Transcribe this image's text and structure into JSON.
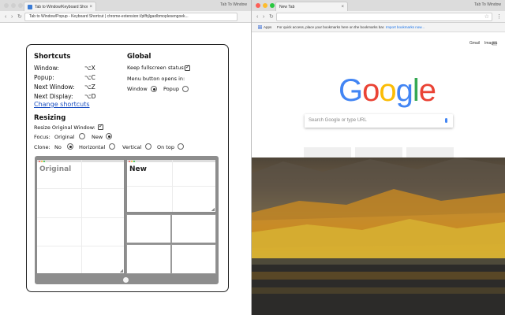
{
  "left_window": {
    "tab_title": "Tab to Window/Keyboard Shor",
    "window_title": "Tab To Window",
    "address": "Tab to Window/Popup - Keyboard Shortcut | chrome-extension://plfhjlgaolbmoplesengoek...",
    "popup": {
      "shortcuts": {
        "heading": "Shortcuts",
        "rows": [
          {
            "label": "Window:",
            "key": "⌥X"
          },
          {
            "label": "Popup:",
            "key": "⌥C"
          },
          {
            "label": "Next Window:",
            "key": "⌥Z"
          },
          {
            "label": "Next Display:",
            "key": "⌥D"
          }
        ],
        "change_link": "Change shortcuts"
      },
      "global": {
        "heading": "Global",
        "keep_fullscreen_label": "Keep fullscreen status:",
        "keep_fullscreen_checked": true,
        "menu_opens_label": "Menu button opens in:",
        "options": [
          {
            "label": "Window",
            "selected": true
          },
          {
            "label": "Popup",
            "selected": false
          }
        ]
      },
      "resizing": {
        "heading": "Resizing",
        "resize_original_label": "Resize Original Window:",
        "resize_original_checked": true,
        "focus_label": "Focus:",
        "focus_options": [
          {
            "label": "Original",
            "selected": false
          },
          {
            "label": "New",
            "selected": true
          }
        ],
        "clone_label": "Clone:",
        "clone_options": [
          {
            "label": "No",
            "selected": true
          },
          {
            "label": "Horizontal",
            "selected": false
          },
          {
            "label": "Vertical",
            "selected": false
          },
          {
            "label": "On top",
            "selected": false
          }
        ]
      },
      "preview": {
        "original_label": "Original",
        "new_label": "New"
      }
    }
  },
  "right_window": {
    "tab_title": "New Tab",
    "window_title": "Tab To Window",
    "bookmarks": {
      "apps_label": "Apps",
      "hint_text": "For quick access, place your bookmarks here on the bookmarks bar.",
      "import_link": "Import bookmarks now..."
    },
    "ntp": {
      "gmail": "Gmail",
      "images": "Images",
      "logo_letters": [
        {
          "ch": "G",
          "color": "#4285f4"
        },
        {
          "ch": "o",
          "color": "#ea4335"
        },
        {
          "ch": "o",
          "color": "#fbbc05"
        },
        {
          "ch": "g",
          "color": "#4285f4"
        },
        {
          "ch": "l",
          "color": "#34a853"
        },
        {
          "ch": "e",
          "color": "#ea4335"
        }
      ],
      "search_placeholder": "Search Google or type URL"
    }
  },
  "colors": {
    "link": "#1a4fc2",
    "close_light": "#fc5f57",
    "min_light": "#fdbc2e",
    "max_light": "#28c840"
  }
}
